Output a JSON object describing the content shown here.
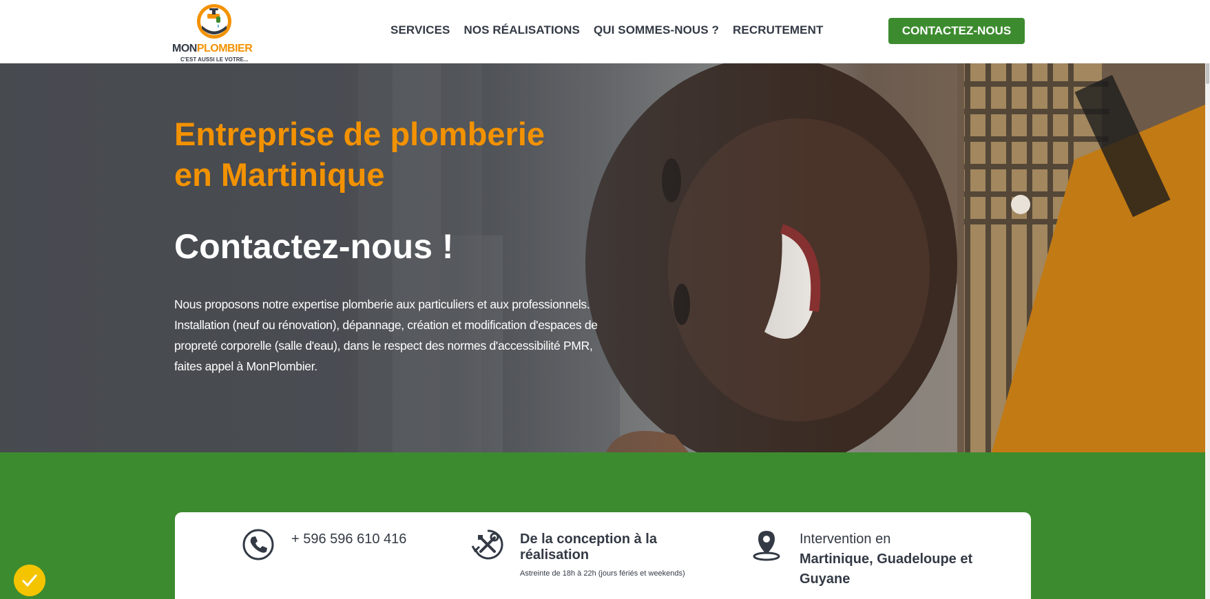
{
  "header": {
    "logo": {
      "brand_left": "MON",
      "brand_right": "PLOMBIER",
      "tagline": "C'EST AUSSI LE VOTRE..."
    },
    "nav": [
      {
        "label": "SERVICES"
      },
      {
        "label": "NOS RÉALISATIONS"
      },
      {
        "label": "QUI SOMMES-NOUS ?"
      },
      {
        "label": "RECRUTEMENT"
      }
    ],
    "cta_label": "CONTACTEZ-NOUS"
  },
  "hero": {
    "title_line1": "Entreprise de plomberie",
    "title_line2": "en Martinique",
    "subtitle": "Contactez-nous !",
    "body_lines": [
      "Nous proposons notre expertise plomberie aux particuliers et aux professionnels.",
      "Installation (neuf ou rénovation), dépannage, création et modification d'espaces de",
      "propreté corporelle (salle d'eau), dans le respect des normes d'accessibilité PMR,",
      "faites appel à MonPlombier."
    ]
  },
  "features": {
    "phone": {
      "icon": "phone-icon",
      "text": "+ 596 596 610 416"
    },
    "service": {
      "icon": "tools-icon",
      "title_line1": "De la conception à la",
      "title_line2": "réalisation",
      "note": "Astreinte de 18h à 22h (jours fériés et weekends)"
    },
    "area": {
      "icon": "location-pin-icon",
      "intro": "Intervention en",
      "line1": "Martinique, Guadeloupe et",
      "line2": "Guyane"
    }
  },
  "colors": {
    "brand_orange": "#f39200",
    "brand_green": "#3d8b2f",
    "text_dark": "#333a45",
    "badge_yellow": "#f5c400"
  }
}
